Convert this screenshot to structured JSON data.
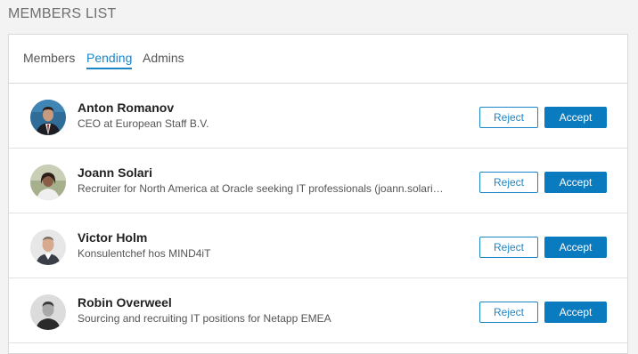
{
  "page": {
    "title": "MEMBERS LIST"
  },
  "tabs": [
    {
      "label": "Members",
      "active": false
    },
    {
      "label": "Pending",
      "active": true
    },
    {
      "label": "Admins",
      "active": false
    }
  ],
  "members": [
    {
      "name": "Anton Romanov",
      "subtitle": "CEO at European Staff B.V.",
      "reject": "Reject",
      "accept": "Accept"
    },
    {
      "name": "Joann Solari",
      "subtitle": "Recruiter for North America at Oracle seeking IT professionals (joann.solari…",
      "reject": "Reject",
      "accept": "Accept"
    },
    {
      "name": "Victor Holm",
      "subtitle": "Konsulentchef hos MIND4iT",
      "reject": "Reject",
      "accept": "Accept"
    },
    {
      "name": "Robin Overweel",
      "subtitle": "Sourcing and recruiting IT positions for Netapp EMEA",
      "reject": "Reject",
      "accept": "Accept"
    }
  ],
  "colors": {
    "accent": "#1a86c7",
    "accept_bg": "#0b7bc0",
    "page_bg": "#f3f3f3"
  }
}
